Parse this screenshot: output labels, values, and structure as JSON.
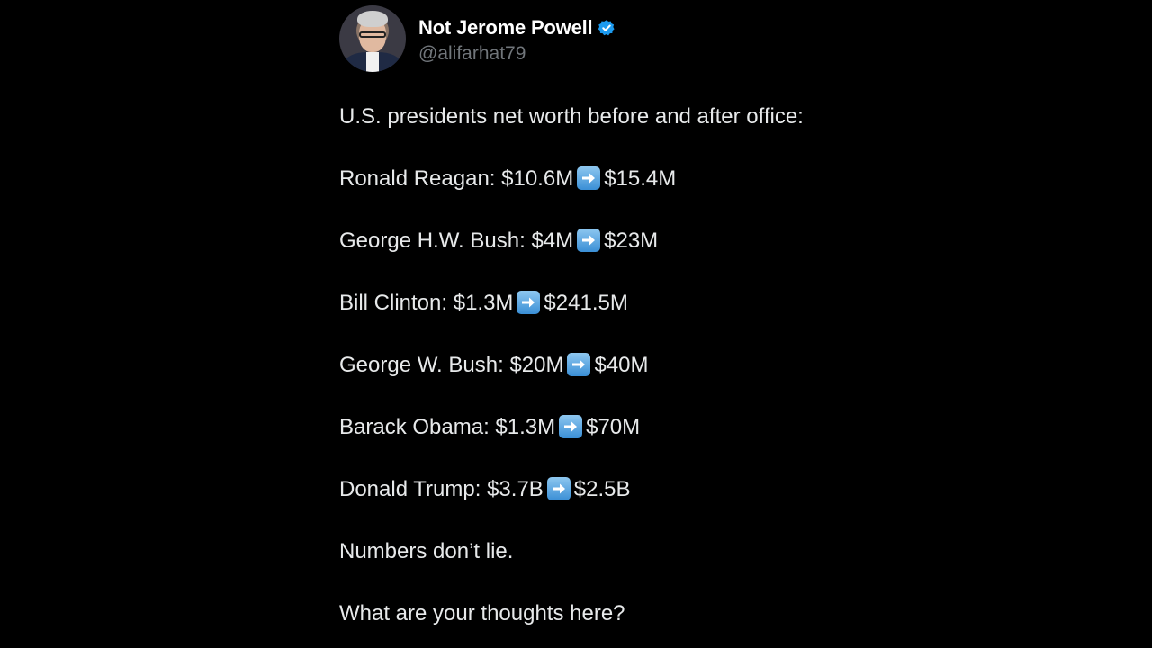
{
  "tweet": {
    "display_name": "Not Jerome Powell",
    "handle": "@alifarhat79",
    "verified": true,
    "accent_color": "#1d9bf0",
    "intro": "U.S. presidents net worth before and after office:",
    "entries": [
      {
        "label": "Ronald Reagan:",
        "before": "$10.6M",
        "after": "$15.4M"
      },
      {
        "label": "George H.W. Bush:",
        "before": "$4M",
        "after": "$23M"
      },
      {
        "label": "Bill Clinton:",
        "before": "$1.3M",
        "after": "$241.5M"
      },
      {
        "label": "George W. Bush:",
        "before": "$20M",
        "after": "$40M"
      },
      {
        "label": "Barack Obama:",
        "before": "$1.3M",
        "after": "$70M"
      },
      {
        "label": "Donald Trump:",
        "before": "$3.7B",
        "after": "$2.5B"
      }
    ],
    "closing_1": "Numbers don’t lie.",
    "closing_2": "What are your thoughts here?"
  }
}
